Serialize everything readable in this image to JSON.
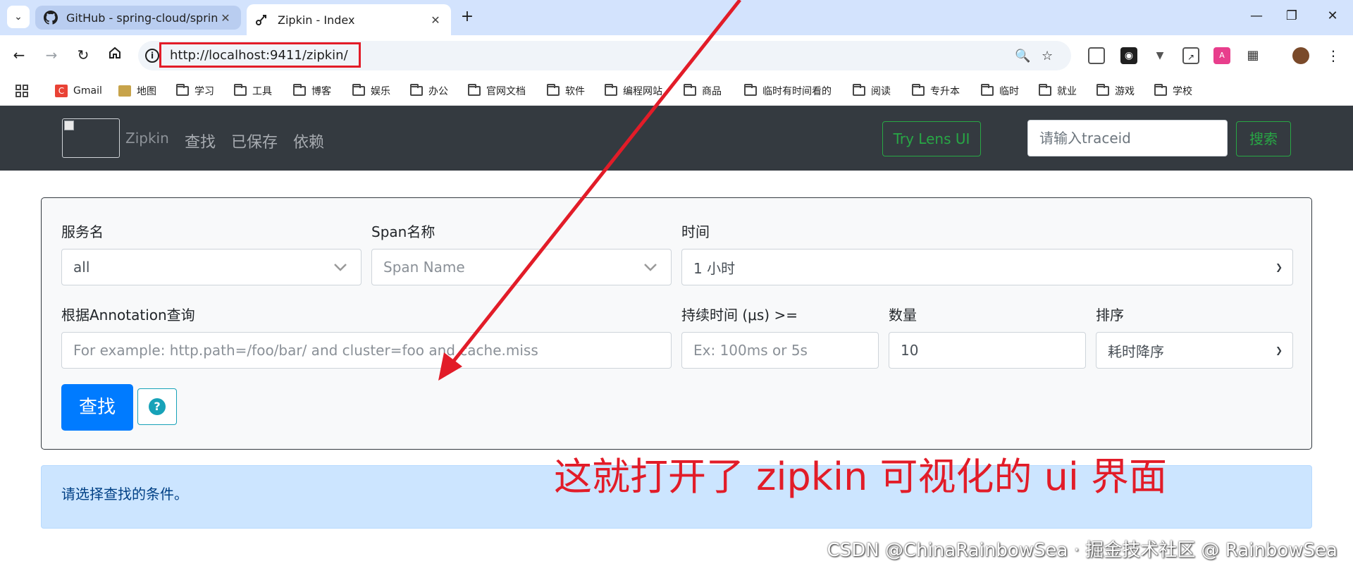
{
  "browser": {
    "tabs": [
      {
        "title": "GitHub - spring-cloud/spring",
        "active": false
      },
      {
        "title": "Zipkin - Index",
        "active": true
      }
    ],
    "url": "http://localhost:9411/zipkin/",
    "bookmarks": [
      "Gmail",
      "地图",
      "学习",
      "工具",
      "博客",
      "娱乐",
      "办公",
      "官网文档",
      "软件",
      "编程网站",
      "商品",
      "临时有时间看的",
      "阅读",
      "专升本",
      "临时",
      "就业",
      "游戏",
      "学校"
    ]
  },
  "navbar": {
    "brand": "Zipkin",
    "links": [
      "查找",
      "已保存",
      "依赖"
    ],
    "lens_button": "Try Lens UI",
    "traceid_placeholder": "请输入traceid",
    "search_button": "搜索"
  },
  "form": {
    "service_label": "服务名",
    "service_value": "all",
    "span_label": "Span名称",
    "span_placeholder": "Span Name",
    "time_label": "时间",
    "time_value": "1 小时",
    "annotation_label": "根据Annotation查询",
    "annotation_placeholder": "For example: http.path=/foo/bar/ and cluster=foo and cache.miss",
    "duration_label": "持续时间 (μs) >=",
    "duration_placeholder": "Ex: 100ms or 5s",
    "limit_label": "数量",
    "limit_value": "10",
    "sort_label": "排序",
    "sort_value": "耗时降序",
    "find_button": "查找",
    "help_icon_glyph": "?"
  },
  "alert": {
    "message": "请选择查找的条件。"
  },
  "annotation": {
    "text": "这就打开了 zipkin 可视化的 ui 界面",
    "color": "#e21c28"
  },
  "watermark": "CSDN @ChinaRainbowSea · 掘金技术社区 @ RainbowSea",
  "colors": {
    "navbar_bg": "#343a40",
    "success": "#28a745",
    "primary": "#007bff",
    "info": "#17a2b8",
    "alert_bg": "#cce5ff"
  }
}
